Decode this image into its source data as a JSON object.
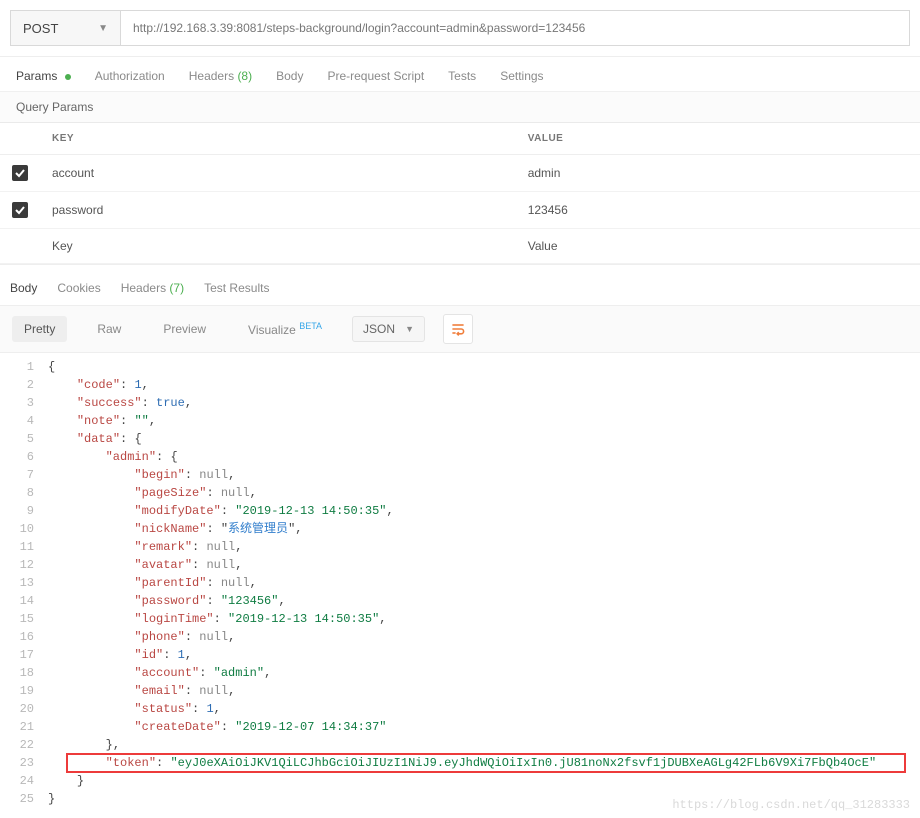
{
  "request": {
    "method": "POST",
    "url": "http://192.168.3.39:8081/steps-background/login?account=admin&password=123456"
  },
  "main_tabs": {
    "params": "Params",
    "authorization": "Authorization",
    "headers": "Headers",
    "headers_count": "(8)",
    "body": "Body",
    "pre_request": "Pre-request Script",
    "tests": "Tests",
    "settings": "Settings"
  },
  "query_params": {
    "section_label": "Query Params",
    "header_key": "KEY",
    "header_value": "VALUE",
    "rows": [
      {
        "enabled": true,
        "key": "account",
        "value": "admin"
      },
      {
        "enabled": true,
        "key": "password",
        "value": "123456"
      }
    ],
    "placeholder_key": "Key",
    "placeholder_value": "Value"
  },
  "response_tabs": {
    "body": "Body",
    "cookies": "Cookies",
    "headers": "Headers",
    "headers_count": "(7)",
    "test_results": "Test Results"
  },
  "view_modes": {
    "pretty": "Pretty",
    "raw": "Raw",
    "preview": "Preview",
    "visualize": "Visualize",
    "visualize_badge": "BETA",
    "format": "JSON"
  },
  "response_json": {
    "code": 1,
    "success": true,
    "note": "",
    "data": {
      "admin": {
        "begin": null,
        "pageSize": null,
        "modifyDate": "2019-12-13 14:50:35",
        "nickName": "系统管理员",
        "remark": null,
        "avatar": null,
        "parentId": null,
        "password": "123456",
        "loginTime": "2019-12-13 14:50:35",
        "phone": null,
        "id": 1,
        "account": "admin",
        "email": null,
        "status": 1,
        "createDate": "2019-12-07 14:34:37"
      },
      "token": "eyJ0eXAiOiJKV1QiLCJhbGciOiJIUzI1NiJ9.eyJhdWQiOiIxIn0.jU81noNx2fsvf1jDUBXeAGLg42FLb6V9Xi7FbQb4OcE"
    }
  },
  "watermark": "https://blog.csdn.net/qq_31283333"
}
